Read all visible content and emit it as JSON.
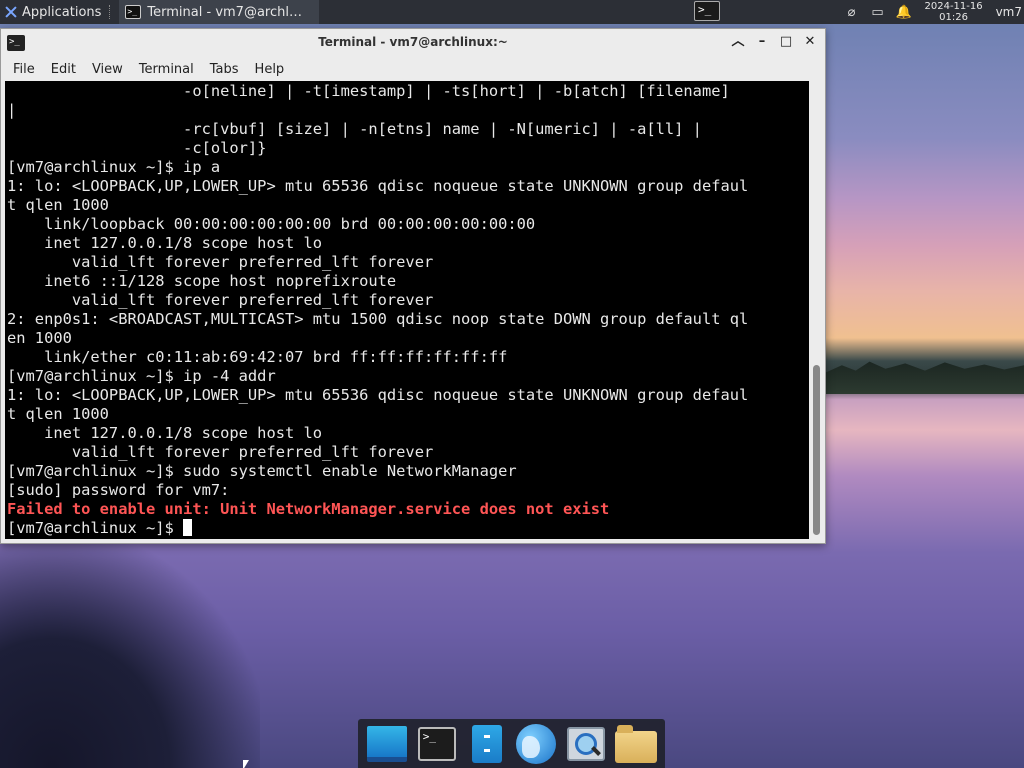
{
  "top_panel": {
    "applications_label": "Applications",
    "task_title": "Terminal - vm7@archl…",
    "date": "2024-11-16",
    "time": "01:26",
    "user": "vm7"
  },
  "window": {
    "title": "Terminal - vm7@archlinux:~",
    "menu": [
      "File",
      "Edit",
      "View",
      "Terminal",
      "Tabs",
      "Help"
    ]
  },
  "terminal": {
    "lines": [
      "                   -o[neline] | -t[imestamp] | -ts[hort] | -b[atch] [filename]",
      "|",
      "                   -rc[vbuf] [size] | -n[etns] name | -N[umeric] | -a[ll] |",
      "                   -c[olor]}",
      "[vm7@archlinux ~]$ ip a",
      "1: lo: <LOOPBACK,UP,LOWER_UP> mtu 65536 qdisc noqueue state UNKNOWN group defaul",
      "t qlen 1000",
      "    link/loopback 00:00:00:00:00:00 brd 00:00:00:00:00:00",
      "    inet 127.0.0.1/8 scope host lo",
      "       valid_lft forever preferred_lft forever",
      "    inet6 ::1/128 scope host noprefixroute",
      "       valid_lft forever preferred_lft forever",
      "2: enp0s1: <BROADCAST,MULTICAST> mtu 1500 qdisc noop state DOWN group default ql",
      "en 1000",
      "    link/ether c0:11:ab:69:42:07 brd ff:ff:ff:ff:ff:ff",
      "[vm7@archlinux ~]$ ip -4 addr",
      "1: lo: <LOOPBACK,UP,LOWER_UP> mtu 65536 qdisc noqueue state UNKNOWN group defaul",
      "t qlen 1000",
      "    inet 127.0.0.1/8 scope host lo",
      "       valid_lft forever preferred_lft forever",
      "[vm7@archlinux ~]$ sudo systemctl enable NetworkManager",
      "[sudo] password for vm7:",
      "Failed to enable unit: Unit NetworkManager.service does not exist"
    ],
    "error_line_index": 22,
    "prompt": "[vm7@archlinux ~]$ "
  },
  "colors": {
    "terminal_bg": "#000000",
    "terminal_fg": "#e8e8e8",
    "error": "#ff5555",
    "panel_bg": "#2c2f36"
  },
  "dock": {
    "icons": [
      "desktop-icon",
      "terminal-icon",
      "file-manager-icon",
      "web-browser-icon",
      "app-finder-icon",
      "folder-icon"
    ]
  }
}
